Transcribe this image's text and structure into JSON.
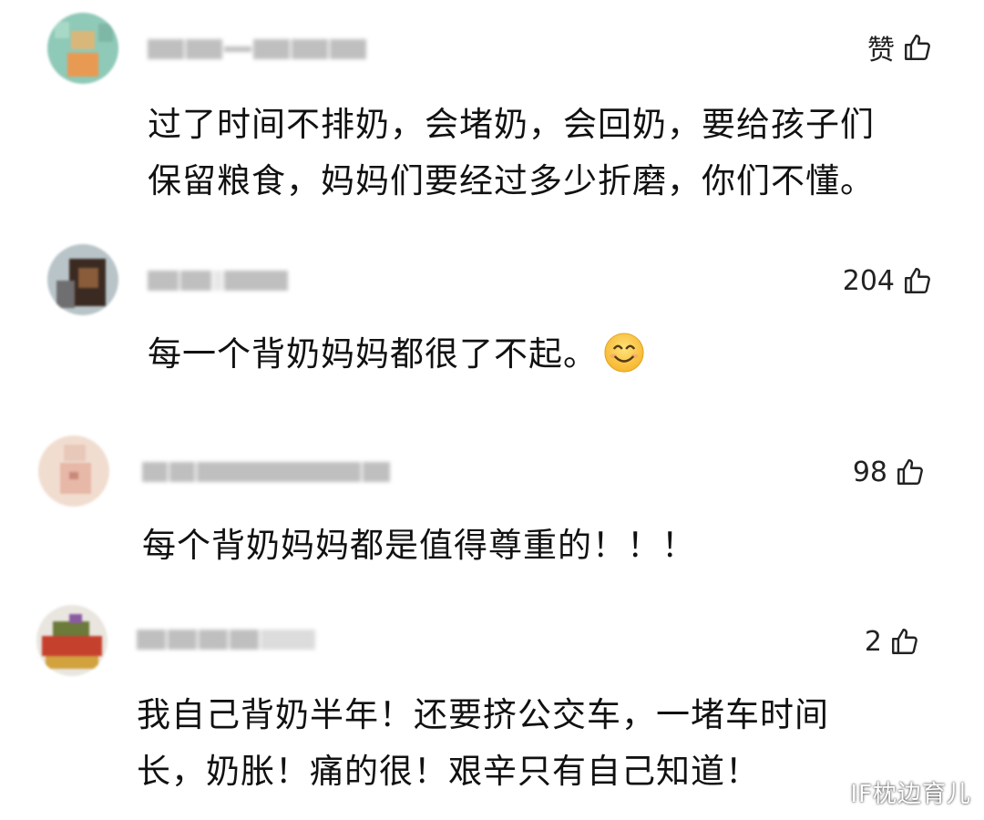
{
  "comments": [
    {
      "like_label": "赞",
      "lines": [
        "过了时间不排奶，会堵奶，会回奶，要给孩子们",
        "保留粮食，妈妈们要经过多少折磨，你们不懂。"
      ]
    },
    {
      "like_label": "204",
      "lines": [
        "每一个背奶妈妈都很了不起。"
      ],
      "emoji": "smiling-face-emoji"
    },
    {
      "like_label": "98",
      "lines": [
        "每个背奶妈妈都是值得尊重的！！！"
      ]
    },
    {
      "like_label": "2",
      "lines": [
        "我自己背奶半年！还要挤公交车，一堵车时间",
        "长，奶胀！痛的很！艰辛只有自己知道！"
      ]
    }
  ],
  "icons": {
    "like": "thumbs-up-icon",
    "emoji": "smiling-face-emoji"
  },
  "watermark": "IF枕边育儿",
  "colors": {
    "text": "#111111",
    "like_count": "#222222",
    "background": "#ffffff"
  }
}
